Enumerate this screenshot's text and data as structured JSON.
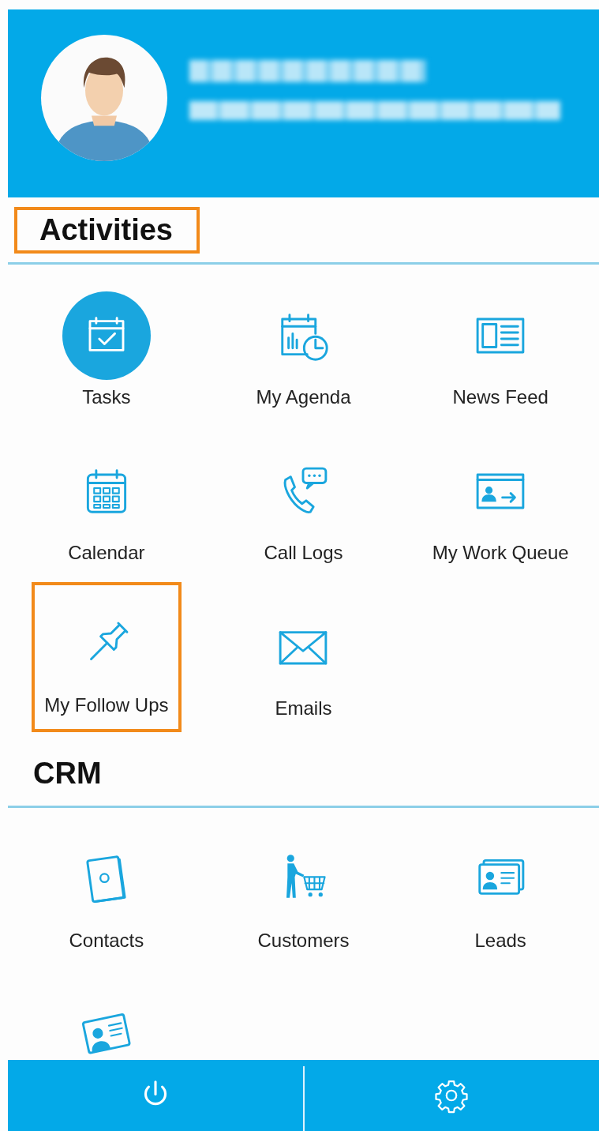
{
  "profile": {
    "redacted": true
  },
  "sections": [
    {
      "title": "Activities",
      "highlighted": true,
      "items": [
        {
          "kind": "tasks",
          "label": "Tasks",
          "selected": true,
          "highlighted": false
        },
        {
          "kind": "agenda",
          "label": "My Agenda",
          "selected": false,
          "highlighted": false
        },
        {
          "kind": "news",
          "label": "News Feed",
          "selected": false,
          "highlighted": false
        },
        {
          "kind": "calendar",
          "label": "Calendar",
          "selected": false,
          "highlighted": false
        },
        {
          "kind": "call",
          "label": "Call Logs",
          "selected": false,
          "highlighted": false
        },
        {
          "kind": "queue",
          "label": "My Work Queue",
          "selected": false,
          "highlighted": false
        },
        {
          "kind": "pin",
          "label": "My Follow Ups",
          "selected": false,
          "highlighted": true
        },
        {
          "kind": "mail",
          "label": "Emails",
          "selected": false,
          "highlighted": false
        }
      ]
    },
    {
      "title": "CRM",
      "highlighted": false,
      "items": [
        {
          "kind": "contacts",
          "label": "Contacts",
          "selected": false,
          "highlighted": false
        },
        {
          "kind": "cart",
          "label": "Customers",
          "selected": false,
          "highlighted": false
        },
        {
          "kind": "cards",
          "label": "Leads",
          "selected": false,
          "highlighted": false
        },
        {
          "kind": "idcard",
          "selected": false,
          "highlighted": false
        }
      ]
    }
  ],
  "bottom_bar": [
    {
      "kind": "power"
    },
    {
      "kind": "settings"
    }
  ]
}
